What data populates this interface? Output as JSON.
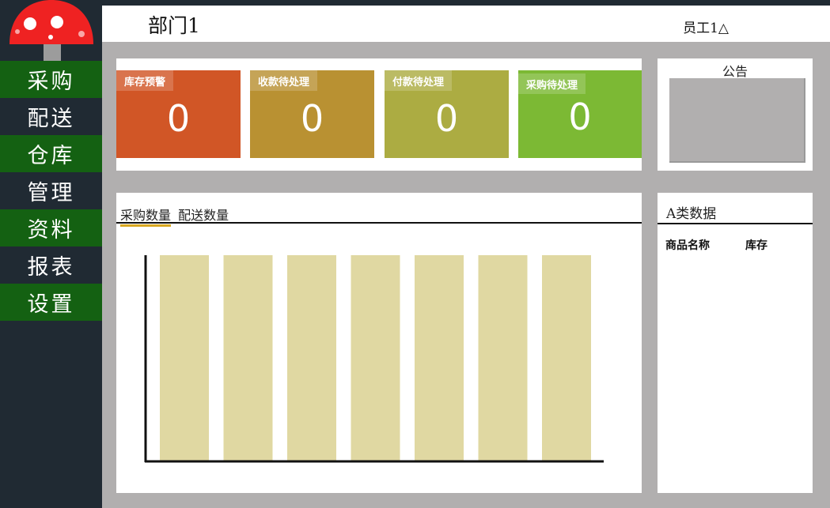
{
  "app": {
    "department": "部门1",
    "user": "员工1△"
  },
  "sidebar": {
    "items": [
      {
        "label": "采购",
        "highlight": true
      },
      {
        "label": "配送",
        "highlight": false
      },
      {
        "label": "仓库",
        "highlight": true
      },
      {
        "label": "管理",
        "highlight": false
      },
      {
        "label": "资料",
        "highlight": true
      },
      {
        "label": "报表",
        "highlight": false
      },
      {
        "label": "设置",
        "highlight": true
      }
    ]
  },
  "stats": [
    {
      "label": "库存预警",
      "value": "0",
      "color": "#d15626"
    },
    {
      "label": "收款待处理",
      "value": "0",
      "color": "#b99132"
    },
    {
      "label": "付款待处理",
      "value": "0",
      "color": "#acac42"
    },
    {
      "label": "采购待处理",
      "value": "0",
      "color": "#7cb934"
    }
  ],
  "notice": {
    "title": "公告"
  },
  "chart_panel": {
    "tabs": [
      "采购数量",
      "配送数量"
    ],
    "active_tab": 0
  },
  "chart_data": {
    "type": "bar",
    "categories": [
      "",
      "",
      "",
      "",
      "",
      "",
      ""
    ],
    "values": [
      100,
      100,
      100,
      100,
      100,
      100,
      100
    ],
    "ylim": [
      0,
      100
    ],
    "bar_color": "#e0d8a2",
    "grid": false
  },
  "a_data": {
    "title": "A类数据",
    "columns": [
      "商品名称",
      "库存"
    ]
  }
}
